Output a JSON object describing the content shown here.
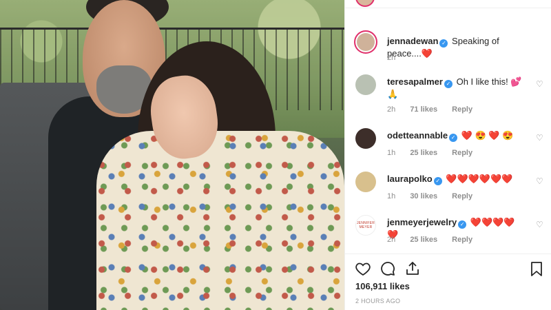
{
  "post": {
    "author": "jennadewan",
    "caption": "Speaking of peace....❤️",
    "caption_time": "2h",
    "likes_count": "106,911 likes",
    "posted_ago": "2 HOURS AGO"
  },
  "comments": [
    {
      "user": "teresapalmer",
      "text": "Oh I like this! 💕🙏",
      "time": "2h",
      "likes": "71 likes",
      "reply": "Reply"
    },
    {
      "user": "odetteannable",
      "text": "❤️ 😍 ❤️ 😍",
      "time": "1h",
      "likes": "25 likes",
      "reply": "Reply"
    },
    {
      "user": "laurapolko",
      "text": "❤️❤️❤️❤️❤️❤️",
      "time": "1h",
      "likes": "30 likes",
      "reply": "Reply"
    },
    {
      "user": "jenmeyerjewelry",
      "text": "❤️❤️❤️❤️❤️",
      "time": "2h",
      "likes": "25 likes",
      "reply": "Reply",
      "avatar_text": "JENNIFER MEYER"
    }
  ],
  "icons": {
    "like": "heart-icon",
    "comment": "comment-icon",
    "share": "share-icon",
    "save": "bookmark-icon",
    "verified": "verified-badge-icon"
  },
  "colors": {
    "verified": "#3897f0",
    "story_ring": "#e1306c",
    "muted_text": "#8e8e8e"
  }
}
